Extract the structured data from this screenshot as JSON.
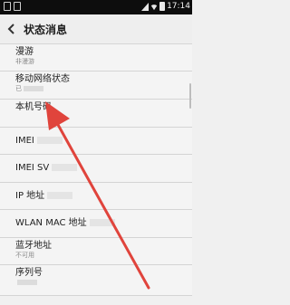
{
  "status_bar": {
    "time": "17:14",
    "icons": [
      "notification-icon",
      "message-icon",
      "signal-icon",
      "wifi-icon",
      "battery-icon"
    ]
  },
  "header": {
    "back_icon": "chevron-left-icon",
    "title": "状态消息"
  },
  "rows": [
    {
      "label": "漫游",
      "value": "非漫游"
    },
    {
      "label": "移动网络状态",
      "value": "已"
    },
    {
      "label": "本机号码",
      "value": ""
    },
    {
      "label": "IMEI",
      "value": ""
    },
    {
      "label": "IMEI SV",
      "value": ""
    },
    {
      "label": "IP 地址",
      "value": ""
    },
    {
      "label": "WLAN MAC 地址",
      "value": ""
    },
    {
      "label": "蓝牙地址",
      "value": "不可用"
    },
    {
      "label": "序列号",
      "value": ""
    }
  ],
  "colors": {
    "annotation_arrow": "#e0443c",
    "header_bg": "#eeeeee",
    "list_bg": "#f4f4f4"
  }
}
